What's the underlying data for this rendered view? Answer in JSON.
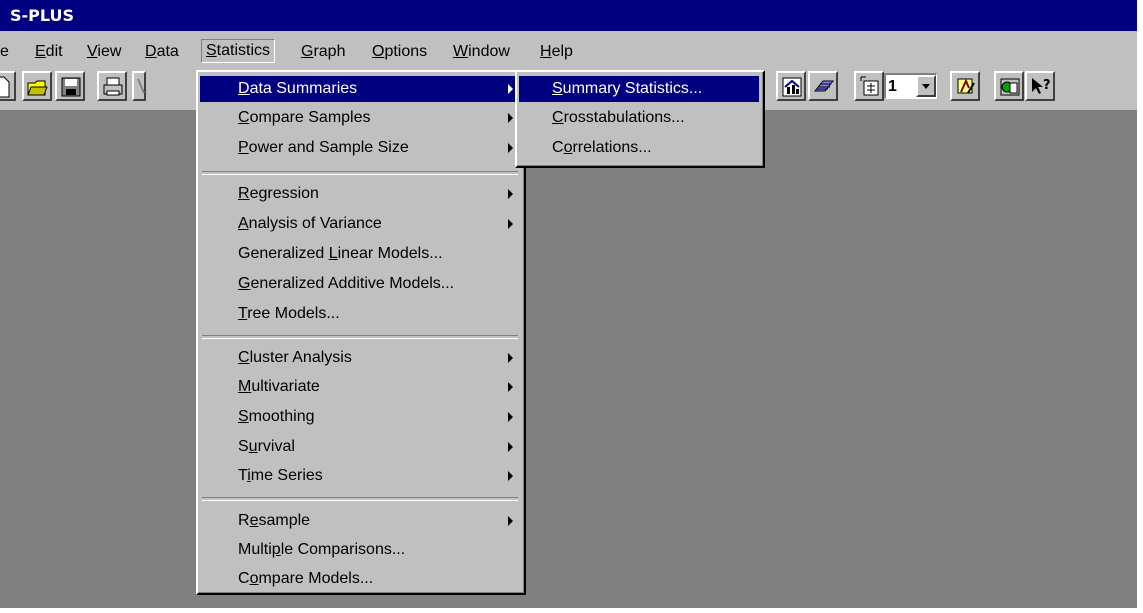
{
  "app": {
    "title": "S-PLUS"
  },
  "menubar": {
    "items": [
      {
        "label": "e",
        "key": ""
      },
      {
        "label": "Edit",
        "key": "E",
        "rest": "dit"
      },
      {
        "label": "View",
        "key": "V",
        "rest": "iew"
      },
      {
        "label": "Data",
        "key": "D",
        "rest": "ata"
      },
      {
        "label": "Statistics",
        "key": "S",
        "rest": "tatistics"
      },
      {
        "label": "Graph",
        "key": "G",
        "rest": "raph"
      },
      {
        "label": "Options",
        "key": "O",
        "rest": "ptions"
      },
      {
        "label": "Window",
        "key": "W",
        "rest": "indow"
      },
      {
        "label": "Help",
        "key": "H",
        "rest": "elp"
      }
    ]
  },
  "toolbar": {
    "icons": [
      "new-document-icon",
      "open-folder-icon",
      "save-icon",
      "print-icon",
      "cut-icon",
      "chart-gallery-icon",
      "3d-plot-icon",
      "graph-page-icon",
      "properties-icon",
      "graph-sheet-icon",
      "help-pointer-icon"
    ],
    "page_combo_value": "1"
  },
  "statistics_menu": {
    "items": [
      {
        "pre": "",
        "key": "D",
        "post": "ata Summaries",
        "submenu": true,
        "highlighted": true
      },
      {
        "pre": "",
        "key": "C",
        "post": "ompare Samples",
        "submenu": true
      },
      {
        "pre": "",
        "key": "P",
        "post": "ower and Sample Size",
        "submenu": true
      },
      {
        "pre": "",
        "key": "R",
        "post": "egression",
        "submenu": true
      },
      {
        "pre": "",
        "key": "A",
        "post": "nalysis of Variance",
        "submenu": true
      },
      {
        "pre": "Generalized ",
        "key": "L",
        "post": "inear Models...",
        "submenu": false
      },
      {
        "pre": "",
        "key": "G",
        "post": "eneralized Additive Models...",
        "submenu": false
      },
      {
        "pre": "",
        "key": "T",
        "post": "ree Models...",
        "submenu": false
      },
      {
        "pre": "",
        "key": "C",
        "post": "luster Analysis",
        "submenu": true
      },
      {
        "pre": "",
        "key": "M",
        "post": "ultivariate",
        "submenu": true
      },
      {
        "pre": "",
        "key": "S",
        "post": "moothing",
        "submenu": true
      },
      {
        "pre": "S",
        "key": "u",
        "post": "rvival",
        "submenu": true
      },
      {
        "pre": "T",
        "key": "i",
        "post": "me Series",
        "submenu": true
      },
      {
        "pre": "R",
        "key": "e",
        "post": "sample",
        "submenu": true
      },
      {
        "pre": "Multi",
        "key": "p",
        "post": "le Comparisons...",
        "submenu": false
      },
      {
        "pre": "C",
        "key": "o",
        "post": "mpare Models...",
        "submenu": false
      }
    ]
  },
  "data_summaries_submenu": {
    "items": [
      {
        "pre": "",
        "key": "S",
        "post": "ummary Statistics...",
        "highlighted": true
      },
      {
        "pre": "",
        "key": "C",
        "post": "rosstabulations..."
      },
      {
        "pre": "C",
        "key": "o",
        "post": "rrelations..."
      }
    ]
  },
  "colors": {
    "titlebar": "#000080",
    "face": "#c0c0c0",
    "workspace": "#808080",
    "highlight": "#000080"
  }
}
